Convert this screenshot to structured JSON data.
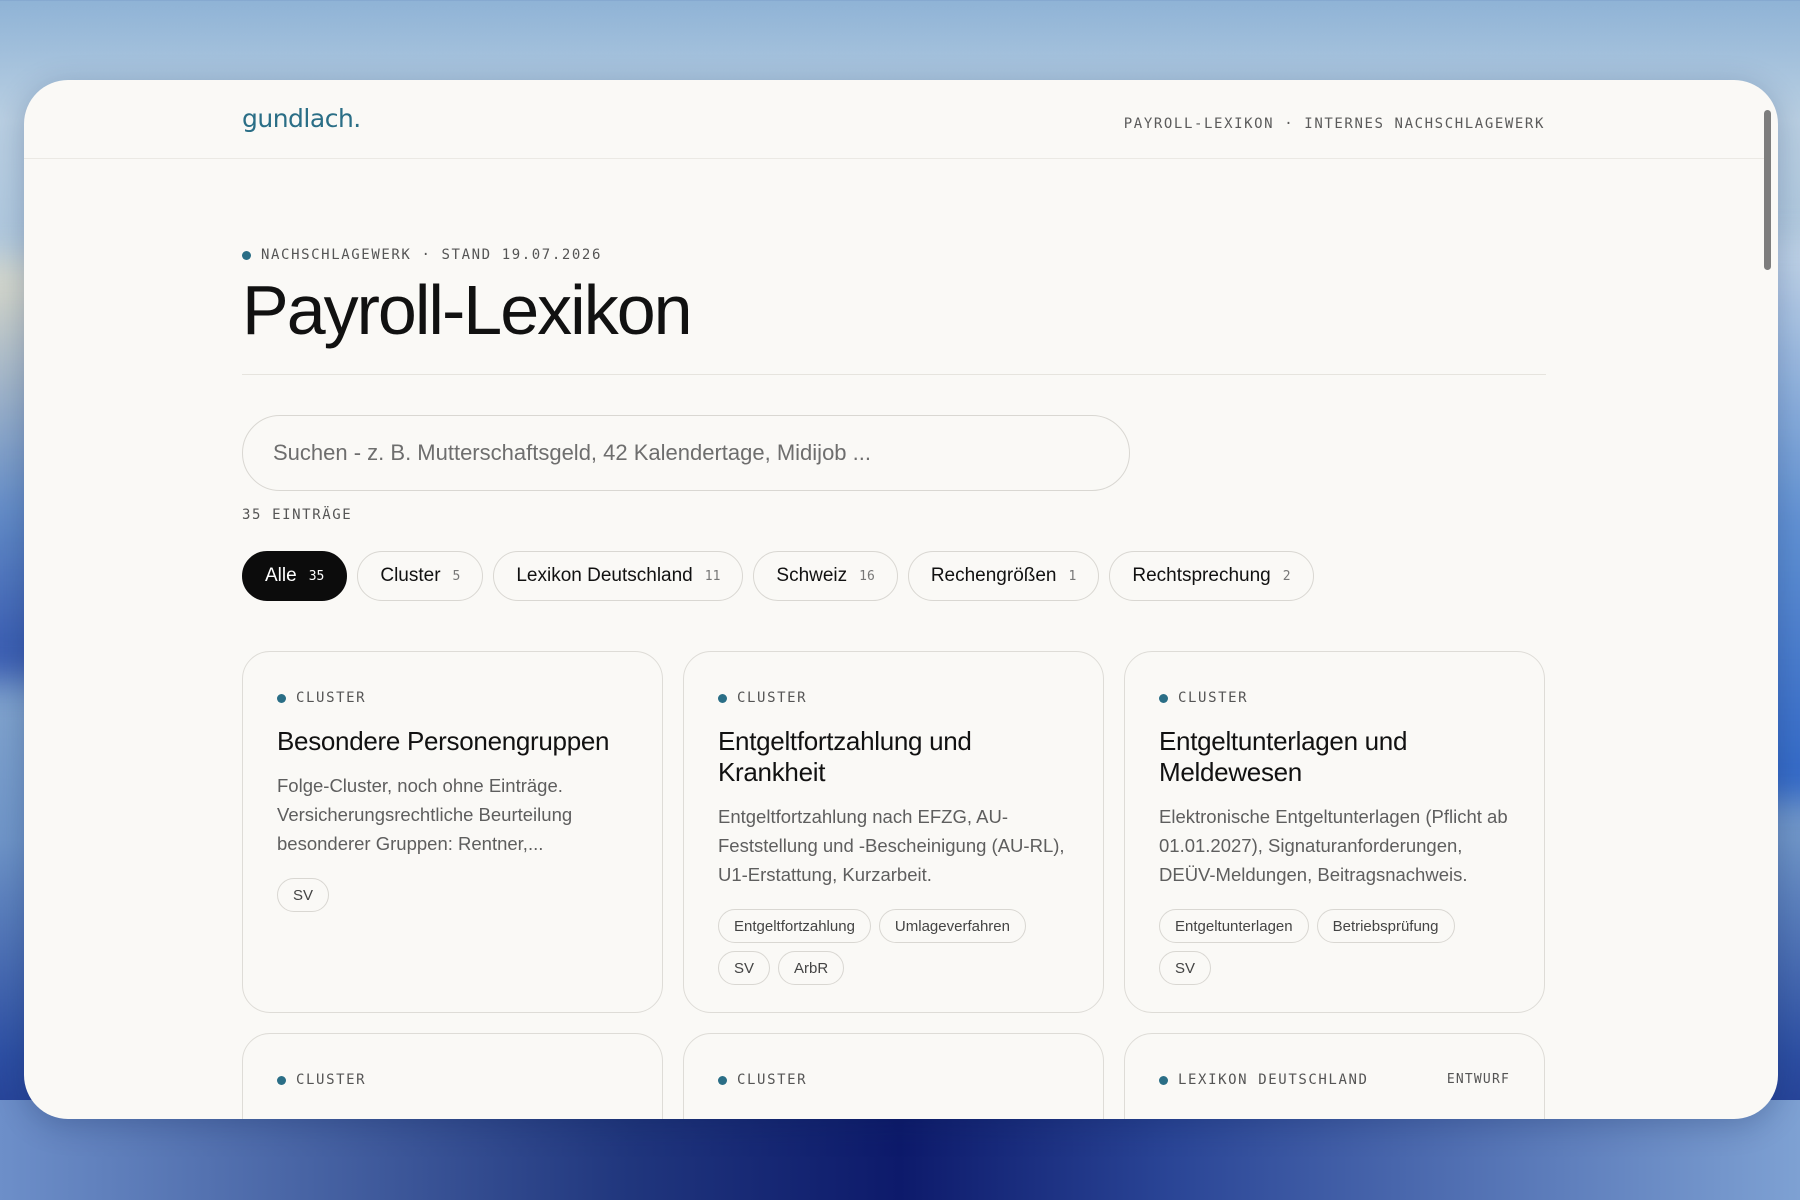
{
  "header": {
    "logo": "gundlach",
    "logo_dot": ".",
    "subtitle": "PAYROLL-LEXIKON · INTERNES NACHSCHLAGEWERK"
  },
  "hero": {
    "kicker": "NACHSCHLAGEWERK · STAND 19.07.2026",
    "title": "Payroll-Lexikon"
  },
  "search": {
    "placeholder": "Suchen - z. B. Mutterschaftsgeld, 42 Kalendertage, Midijob ...",
    "value": ""
  },
  "entry_count": "35 EINTRÄGE",
  "filters": [
    {
      "label": "Alle",
      "count": "35",
      "active": true
    },
    {
      "label": "Cluster",
      "count": "5"
    },
    {
      "label": "Lexikon Deutschland",
      "count": "11"
    },
    {
      "label": "Schweiz",
      "count": "16"
    },
    {
      "label": "Rechengrößen",
      "count": "1"
    },
    {
      "label": "Rechtsprechung",
      "count": "2"
    }
  ],
  "cards": [
    {
      "category": "CLUSTER",
      "title": "Besondere Personengruppen",
      "description": "Folge-Cluster, noch ohne Einträge. Versicherungsrechtliche Beurteilung besonderer Gruppen: Rentner,...",
      "tags": [
        "SV"
      ]
    },
    {
      "category": "CLUSTER",
      "title": "Entgeltfortzahlung und Krankheit",
      "description": "Entgeltfortzahlung nach EFZG, AU-Feststellung und -Bescheinigung (AU-RL), U1-Erstattung, Kurzarbeit.",
      "tags": [
        "Entgeltfortzahlung",
        "Umlageverfahren",
        "SV",
        "ArbR"
      ]
    },
    {
      "category": "CLUSTER",
      "title": "Entgeltunterlagen und Meldewesen",
      "description": "Elektronische Entgeltunterlagen (Pflicht ab 01.01.2027), Signaturanforderungen, DEÜV-Meldungen, Beitragsnachweis.",
      "tags": [
        "Entgeltunterlagen",
        "Betriebsprüfung",
        "SV"
      ]
    },
    {
      "category": "CLUSTER"
    },
    {
      "category": "CLUSTER"
    },
    {
      "category": "LEXIKON DEUTSCHLAND",
      "status": "ENTWURF"
    }
  ],
  "colors": {
    "accent": "#2a6e86",
    "active_chip": "#0c0c0c",
    "background": "#faf9f6"
  }
}
